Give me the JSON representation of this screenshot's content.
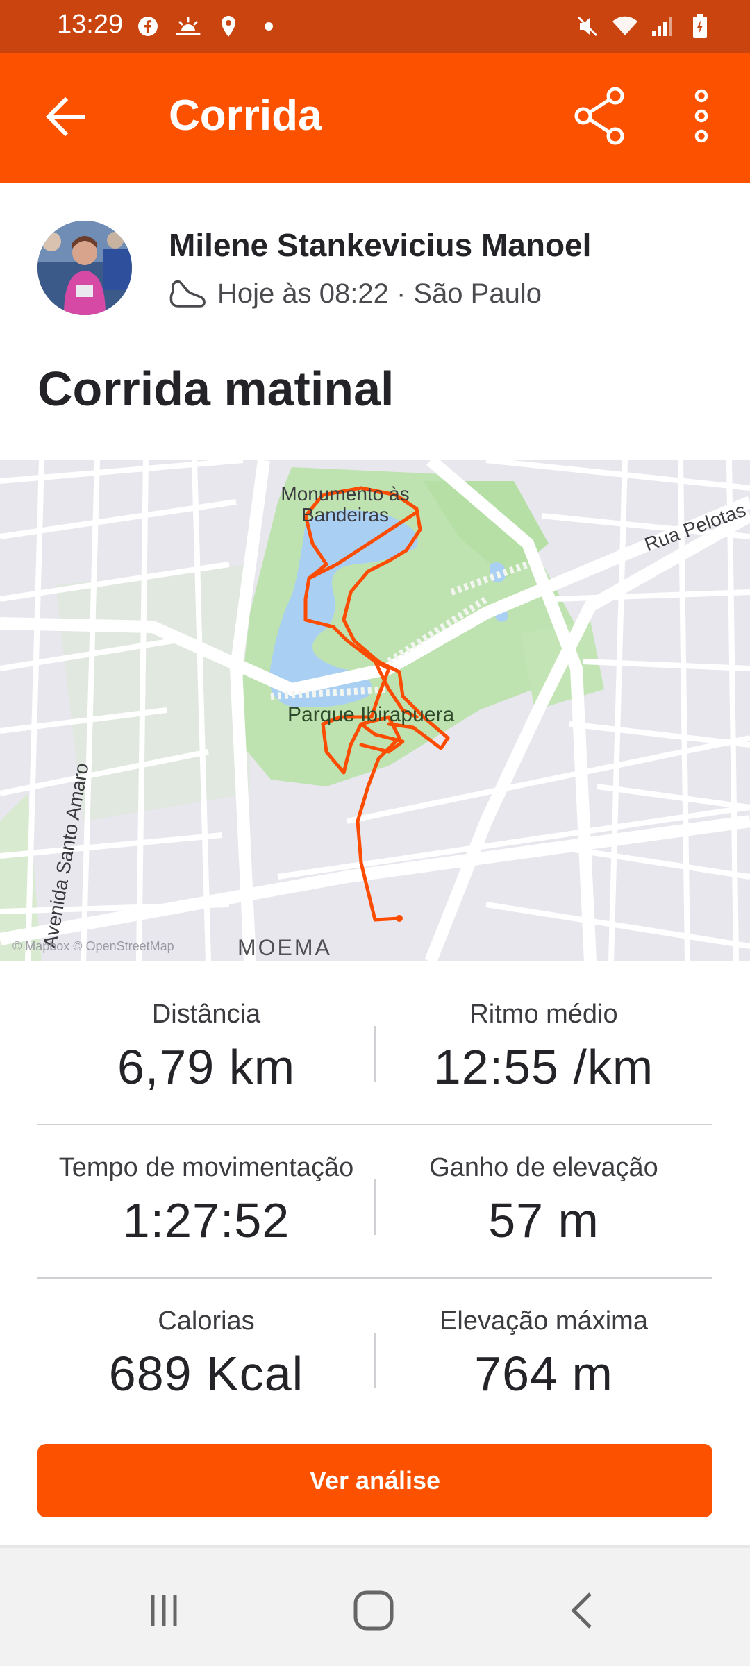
{
  "status_bar": {
    "time": "13:29",
    "left_icons": [
      "facebook-icon",
      "weather-icon",
      "location-icon",
      "dot-icon"
    ],
    "right_icons": [
      "mute-icon",
      "wifi-icon",
      "signal-icon",
      "battery-icon"
    ]
  },
  "app_bar": {
    "title": "Corrida",
    "back_icon": "arrow-left-icon",
    "share_icon": "share-icon",
    "more_icon": "more-vertical-icon"
  },
  "athlete": {
    "name": "Milene Stankevicius Manoel",
    "activity_icon": "running-shoe-icon",
    "meta": "Hoje às 08:22 · São Paulo"
  },
  "activity": {
    "title": "Corrida matinal"
  },
  "map": {
    "labels": {
      "monument": "Monumento às Bandeiras",
      "park": "Parque Ibirapuera",
      "street_1": "Rua Pelotas",
      "street_2": "Avenida Santo Amaro",
      "district": "MOEMA",
      "attribution": "© Mapbox © OpenStreetMap"
    },
    "route_color": "#FC4C02"
  },
  "stats": [
    {
      "label": "Distância",
      "value": "6,79 km"
    },
    {
      "label": "Ritmo médio",
      "value": "12:55 /km"
    },
    {
      "label": "Tempo de movimentação",
      "value": "1:27:52"
    },
    {
      "label": "Ganho de elevação",
      "value": "57 m"
    },
    {
      "label": "Calorias",
      "value": "689 Kcal"
    },
    {
      "label": "Elevação máxima",
      "value": "764 m"
    }
  ],
  "cta": {
    "label": "Ver análise"
  },
  "nav_bar": {
    "icons": [
      "recent-apps-icon",
      "home-icon",
      "back-icon"
    ]
  },
  "colors": {
    "brand": "#FC5200",
    "status_bar": "#C9440E"
  }
}
